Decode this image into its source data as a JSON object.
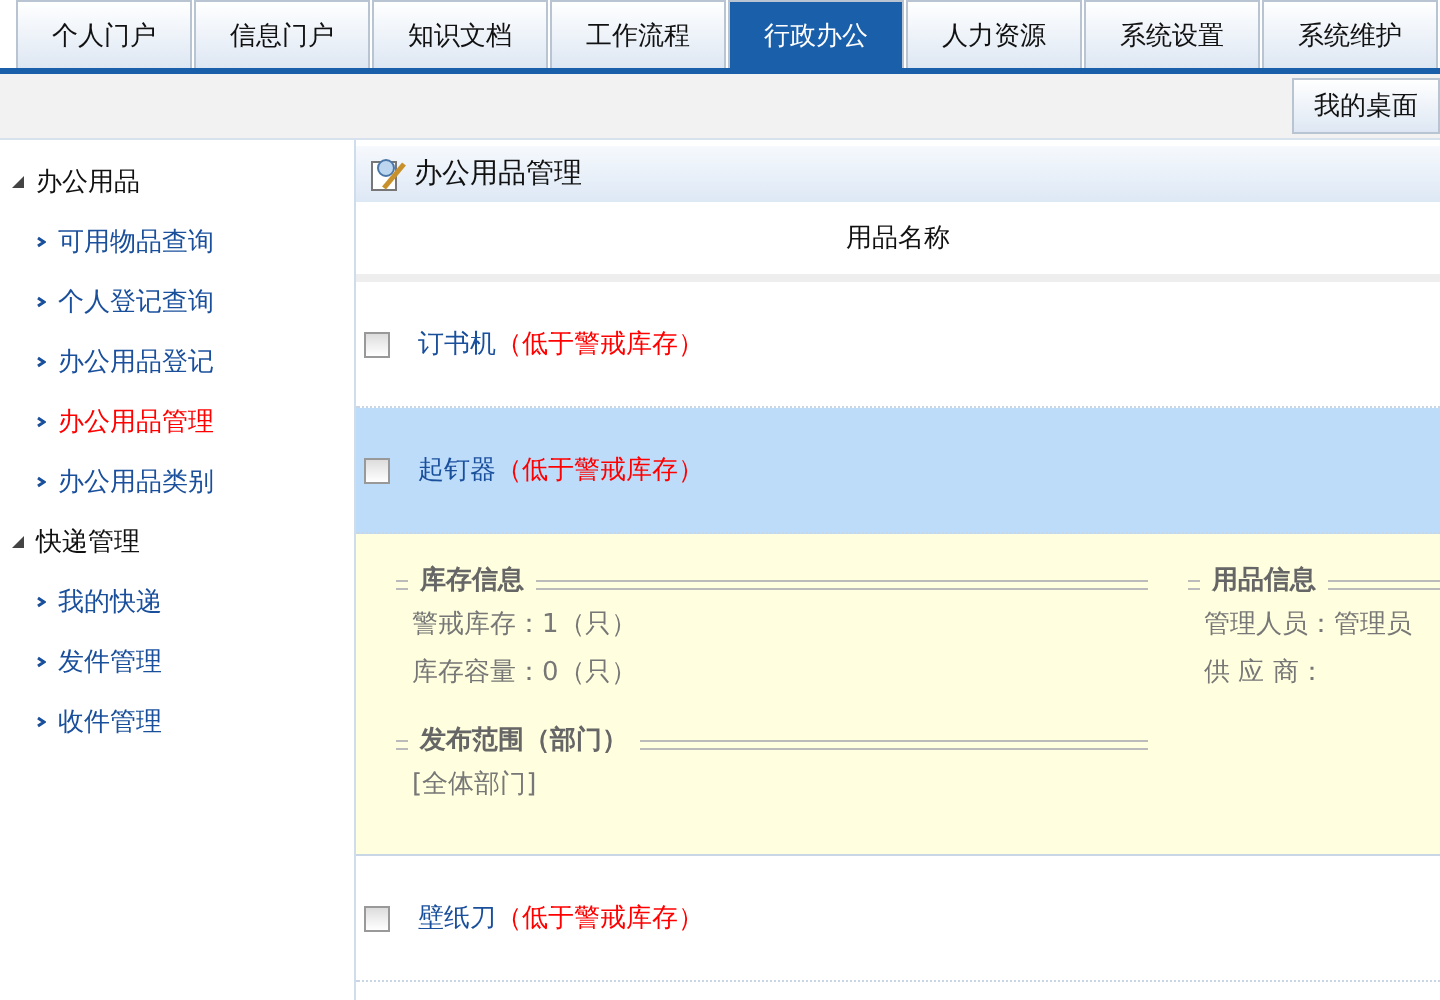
{
  "tabs": [
    {
      "label": "个人门户",
      "selected": false
    },
    {
      "label": "信息门户",
      "selected": false
    },
    {
      "label": "知识文档",
      "selected": false
    },
    {
      "label": "工作流程",
      "selected": false
    },
    {
      "label": "行政办公",
      "selected": true
    },
    {
      "label": "人力资源",
      "selected": false
    },
    {
      "label": "系统设置",
      "selected": false
    },
    {
      "label": "系统维护",
      "selected": false
    }
  ],
  "toolbar": {
    "button": "我的桌面"
  },
  "sidebar": {
    "groups": [
      {
        "label": "办公用品",
        "expanded": true,
        "items": [
          {
            "label": "可用物品查询",
            "selected": false
          },
          {
            "label": "个人登记查询",
            "selected": false
          },
          {
            "label": "办公用品登记",
            "selected": false
          },
          {
            "label": "办公用品管理",
            "selected": true
          },
          {
            "label": "办公用品类别",
            "selected": false
          }
        ]
      },
      {
        "label": "快递管理",
        "expanded": true,
        "items": [
          {
            "label": "我的快递",
            "selected": false
          },
          {
            "label": "发件管理",
            "selected": false
          },
          {
            "label": "收件管理",
            "selected": false
          }
        ]
      }
    ]
  },
  "main": {
    "title": "办公用品管理",
    "column": "用品名称",
    "rows": [
      {
        "name": "订书机",
        "note": "（低于警戒库存）",
        "checked": false,
        "selected": false
      },
      {
        "name": "起钉器",
        "note": "（低于警戒库存）",
        "checked": false,
        "selected": true,
        "expanded": true,
        "detail": {
          "left": [
            {
              "title": "库存信息",
              "lines": [
                "警戒库存：1（只）",
                "库存容量：0（只）"
              ]
            },
            {
              "title": "发布范围（部门）",
              "lines": [
                "[全体部门]"
              ]
            }
          ],
          "right": [
            {
              "title": "用品信息",
              "lines": [
                "管理人员：管理员",
                "供 应 商："
              ]
            }
          ]
        }
      },
      {
        "name": "壁纸刀",
        "note": "（低于警戒库存）",
        "checked": false,
        "selected": false
      }
    ]
  }
}
